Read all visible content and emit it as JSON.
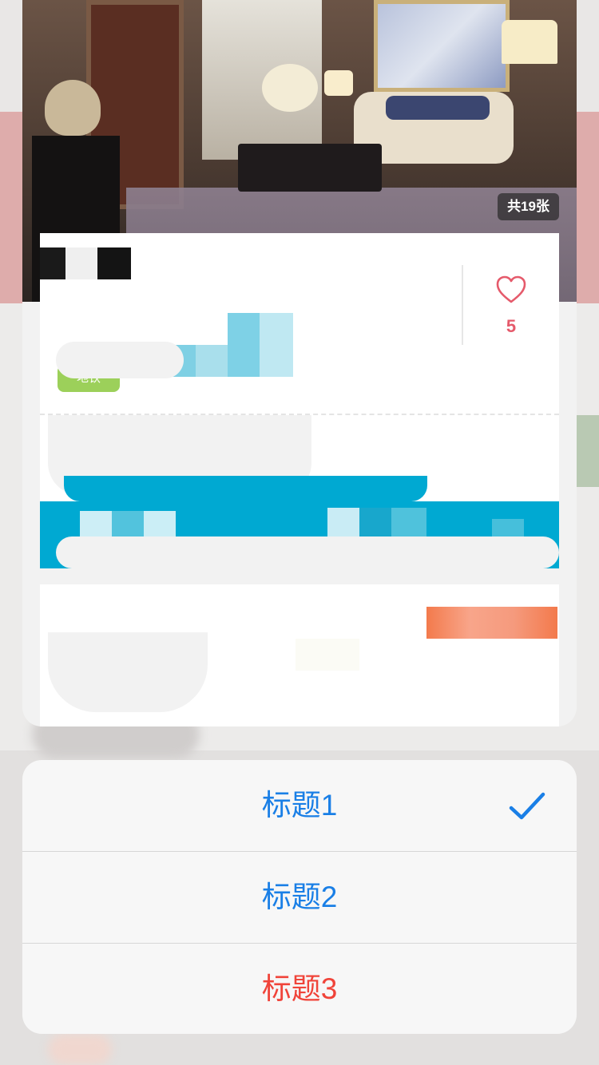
{
  "photo": {
    "count_badge": "共19张"
  },
  "favorite": {
    "count": "5",
    "icon": "heart-icon"
  },
  "tag": {
    "label": "地铁"
  },
  "action_sheet": {
    "items": [
      {
        "label": "标题1",
        "selected": true,
        "style": "default"
      },
      {
        "label": "标题2",
        "selected": false,
        "style": "default"
      },
      {
        "label": "标题3",
        "selected": false,
        "style": "destructive"
      }
    ],
    "check_icon": "checkmark-icon"
  },
  "colors": {
    "accent_blue": "#1a7fe6",
    "destructive_red": "#f0443a",
    "favorite_pink": "#e55a6b",
    "tag_green": "#9cd05a",
    "banner_blue": "#00a9d2",
    "orange": "#f37a4c"
  }
}
